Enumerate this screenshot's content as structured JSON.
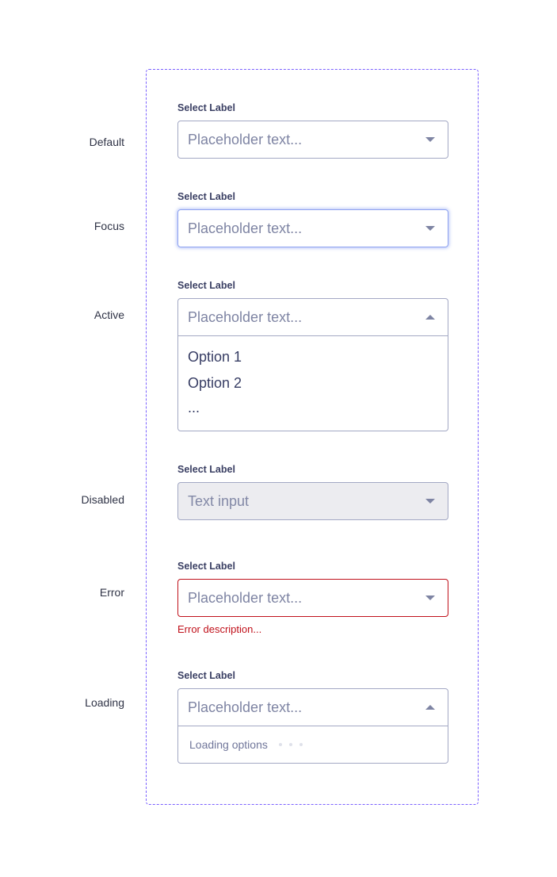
{
  "states": [
    {
      "key": "default",
      "state_label": "Default",
      "field_label": "Select Label",
      "value": "Placeholder text...",
      "caret": "caret-down-icon"
    },
    {
      "key": "focus",
      "state_label": "Focus",
      "field_label": "Select Label",
      "value": "Placeholder text...",
      "caret": "caret-down-icon"
    },
    {
      "key": "active",
      "state_label": "Active",
      "field_label": "Select Label",
      "value": "Placeholder text...",
      "caret": "caret-up-icon",
      "options": [
        "Option 1",
        "Option 2",
        "..."
      ]
    },
    {
      "key": "disabled",
      "state_label": "Disabled",
      "field_label": "Select Label",
      "value": "Text input",
      "caret": "caret-down-icon"
    },
    {
      "key": "error",
      "state_label": "Error",
      "field_label": "Select Label",
      "value": "Placeholder text...",
      "caret": "caret-down-icon",
      "error_text": "Error description..."
    },
    {
      "key": "loading",
      "state_label": "Loading",
      "field_label": "Select Label",
      "value": "Placeholder text...",
      "caret": "caret-up-icon",
      "loading_text": "Loading options"
    }
  ],
  "colors": {
    "frame_border": "#7b61ff",
    "input_border": "#a3a8c4",
    "focus_ring": "#8fa3f0",
    "error": "#c0111b",
    "disabled_bg": "#ececf0",
    "placeholder": "#7e84a3",
    "label": "#3a3f63"
  }
}
